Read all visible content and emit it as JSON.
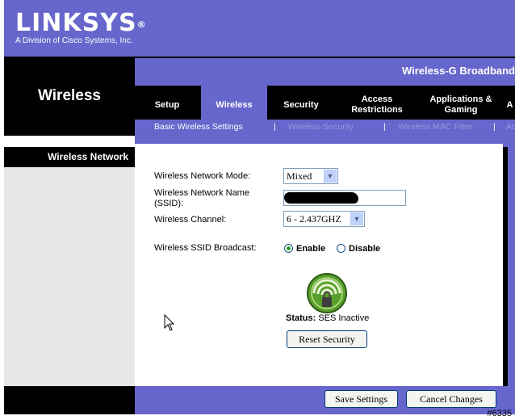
{
  "brand": {
    "logo": "LINKSYS",
    "reg_mark": "®",
    "subtitle": "A Division of Cisco Systems, Inc."
  },
  "header": {
    "product_title": "Wireless-G Broadband",
    "section": "Wireless"
  },
  "tabs": [
    {
      "label": "Setup"
    },
    {
      "label": "Wireless"
    },
    {
      "label": "Security"
    },
    {
      "label": "Access Restrictions"
    },
    {
      "label": "Applications & Gaming"
    },
    {
      "label": "A"
    }
  ],
  "subtabs": [
    {
      "label": "Basic Wireless Settings"
    },
    {
      "label": "Wireless Security"
    },
    {
      "label": "Wireless MAC Filter"
    },
    {
      "label": "Ad"
    }
  ],
  "separator": "|",
  "sidebar": {
    "section_label": "Wireless Network"
  },
  "form": {
    "mode_label": "Wireless Network Mode:",
    "mode_value": "Mixed",
    "name_label_line1": "Wireless Network Name",
    "name_label_line2": "(SSID):",
    "channel_label": "Wireless Channel:",
    "channel_value": "6 - 2.437GHZ",
    "broadcast_label": "Wireless SSID Broadcast:",
    "enable_label": "Enable",
    "disable_label": "Disable",
    "broadcast_selected": "Enable"
  },
  "ses": {
    "status_label": "Status:",
    "status_value": "SES Inactive",
    "reset_button": "Reset Security"
  },
  "footer": {
    "save_button": "Save Settings",
    "cancel_button": "Cancel Changes"
  },
  "watermark": "#6335",
  "colors": {
    "accent": "#6666cc",
    "black": "#000000",
    "sidebar_gray": "#e7e7e7",
    "ses_green": "#5aa02c"
  }
}
